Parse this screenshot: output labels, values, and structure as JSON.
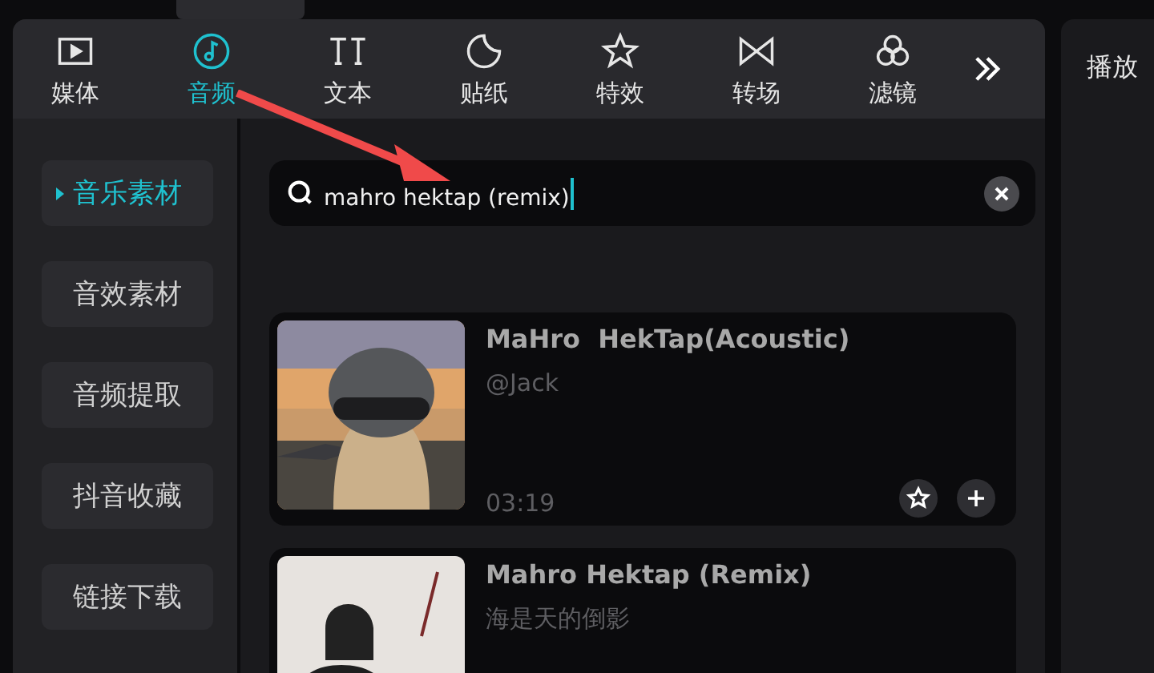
{
  "tabs": [
    {
      "label": "媒体",
      "selected": false
    },
    {
      "label": "音频",
      "selected": true
    },
    {
      "label": "文本",
      "selected": false
    },
    {
      "label": "贴纸",
      "selected": false
    },
    {
      "label": "特效",
      "selected": false
    },
    {
      "label": "转场",
      "selected": false
    },
    {
      "label": "滤镜",
      "selected": false
    }
  ],
  "side_panel": {
    "title": "播放"
  },
  "sidebar": {
    "items": [
      {
        "label": "音乐素材",
        "selected": true
      },
      {
        "label": "音效素材",
        "selected": false
      },
      {
        "label": "音频提取",
        "selected": false
      },
      {
        "label": "抖音收藏",
        "selected": false
      },
      {
        "label": "链接下载",
        "selected": false
      }
    ]
  },
  "search": {
    "value": "mahro hektap (remix)"
  },
  "tracks": [
    {
      "title": "MaHro  HekTap(Acoustic)",
      "artist": "@Jack",
      "duration": "03:19",
      "actions": true
    },
    {
      "title": "Mahro Hektap (Remix)",
      "artist": "海是天的倒影"
    }
  ]
}
